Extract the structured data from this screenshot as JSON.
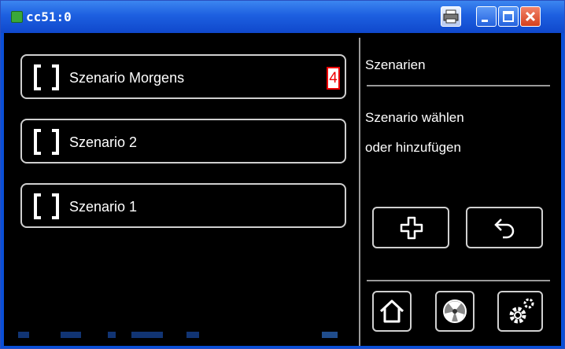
{
  "window": {
    "title": "cc51:0",
    "buttons": [
      "printer-icon",
      "minimize-icon",
      "maximize-icon",
      "close-icon"
    ]
  },
  "scenarios": [
    {
      "label": "Szenario Morgens",
      "badge": "4"
    },
    {
      "label": "Szenario 2"
    },
    {
      "label": "Szenario 1"
    }
  ],
  "panel": {
    "title": "Szenarien",
    "description_line1": "Szenario wählen",
    "description_line2": "oder hinzufügen"
  },
  "actions": [
    "add-icon",
    "back-icon"
  ],
  "nav": [
    "home-icon",
    "fan-icon",
    "settings-icon"
  ],
  "colors": {
    "titlebar": "#1d5fe0",
    "screen": "#000000",
    "border": "#cfcfcf",
    "badge": "#e00000"
  }
}
